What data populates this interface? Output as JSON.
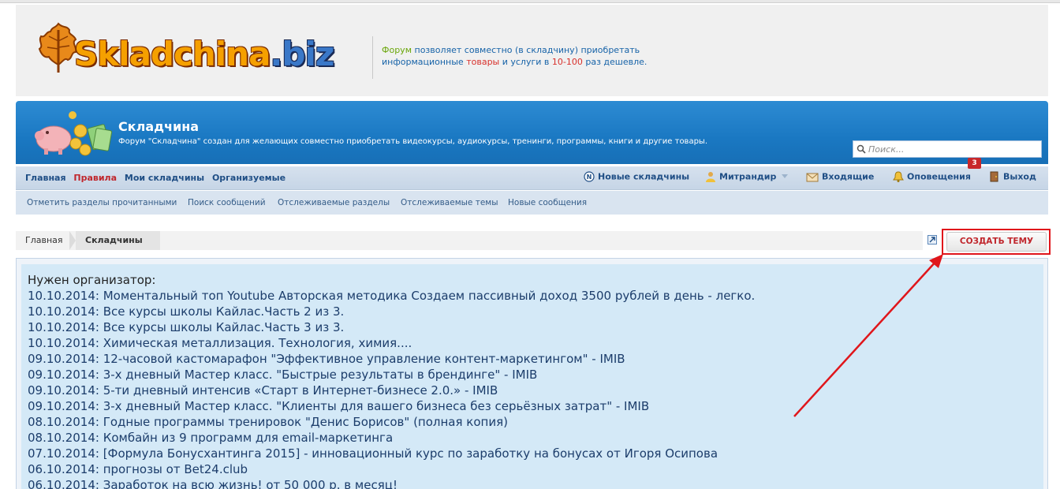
{
  "header": {
    "logo_main": "Skladchina",
    "logo_tld": ".biz",
    "tagline": {
      "w1": "Форум",
      "w2": " позволяет совместно (в складчину) приобретать",
      "w3": "информационные ",
      "w4": "товары",
      "w5": " и услуги в ",
      "w6": "10-100",
      "w7": " раз дешевле."
    }
  },
  "banner": {
    "title": "Складчина",
    "description": "Форум \"Складчина\" создан для желающих совместно приобретать видеокурсы, аудиокурсы, тренинги, программы, книги и другие товары.",
    "search_placeholder": "Поиск..."
  },
  "nav": {
    "left": [
      "Главная",
      "Правила",
      "Мои складчины",
      "Организуемые"
    ],
    "new_label": "Новые складчины",
    "user_label": "Митрандир",
    "inbox_label": "Входящие",
    "alerts_label": "Оповещения",
    "alerts_count": "3",
    "logout_label": "Выход"
  },
  "subnav": [
    "Отметить разделы прочитанными",
    "Поиск сообщений",
    "Отслеживаемые разделы",
    "Отслеживаемые темы",
    "Новые сообщения"
  ],
  "breadcrumb": {
    "home": "Главная",
    "current": "Складчины"
  },
  "create_button": "СОЗДАТЬ ТЕМУ",
  "content": {
    "title": "Нужен организатор:",
    "rows": [
      "10.10.2014: Моментальный топ Youtube Авторская методика Создаем пассивный доход 3500 рублей в день - легко.",
      "10.10.2014: Все курсы школы Кайлас.Часть 2 из 3.",
      "10.10.2014: Все курсы школы Кайлас.Часть 3 из 3.",
      "10.10.2014: Химическая металлизация. Технология, химия....",
      "09.10.2014: 12-часовой кастомарафон \"Эффективное управление контент-маркетингом\" - IMIB",
      "09.10.2014: 3-х дневный Мастер класс. \"Быстрые результаты в брендинге\" - IMIB",
      "09.10.2014: 5-ти дневный интенсив «Старт в Интернет-бизнесе 2.0.» - IMIB",
      "09.10.2014: 3-х дневный Мастер класс. \"Клиенты для вашего бизнеса без серьёзных затрат\" - IMIB",
      "08.10.2014: Годные программы тренировок \"Денис Борисов\" (полная копия)",
      "08.10.2014: Комбайн из 9 программ для email-маркетинга",
      "07.10.2014: [Формула Бонусхантинга 2015] - инновационный курс по заработку на бонусах от Игоря Осипова",
      "06.10.2014: прогнозы от Bet24.club",
      "06.10.2014: Заработок на всю жизнь! от 50 000 р. в месяц!"
    ]
  },
  "colors": {
    "accent_blue": "#1a78c2",
    "link": "#1f4e85",
    "alert_red": "#c8272b",
    "annotation_red": "#e0161b"
  }
}
